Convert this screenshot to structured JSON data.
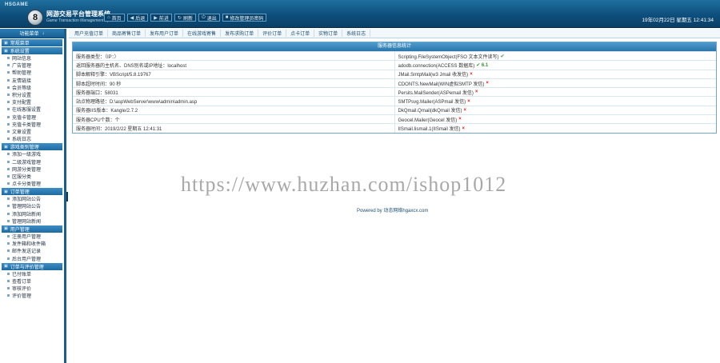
{
  "header": {
    "brand_tag": "HSGAME",
    "logo_letter": "8",
    "title": "网游交易平台管理系统",
    "subtitle": "Game Transaction Management System",
    "nav": [
      {
        "icon": "home-icon",
        "glyph": "⌂",
        "label": "首页"
      },
      {
        "icon": "back-icon",
        "glyph": "◀",
        "label": "后退"
      },
      {
        "icon": "forward-icon",
        "glyph": "▶",
        "label": "前进"
      },
      {
        "icon": "refresh-icon",
        "glyph": "↻",
        "label": "刷新"
      },
      {
        "icon": "logout-icon",
        "glyph": "⏻",
        "label": "退出"
      },
      {
        "icon": "user-icon",
        "glyph": "■",
        "label": "修改管理员密码"
      }
    ],
    "clock": "19年02月22日 星期五 12:41:34"
  },
  "sidebar": {
    "head_left": "功能菜单",
    "head_right": "↓",
    "sections": [
      {
        "title": "常规菜单",
        "items": []
      },
      {
        "title": "系统设置",
        "items": [
          "网站信息",
          "广告管理",
          "帮助管理",
          "友情链接",
          "会员等级",
          "积分设置",
          "支付配置",
          "在线客服设置",
          "充值卡管理",
          "充值卡类管理",
          "文章设置",
          "系统日志"
        ]
      },
      {
        "title": "游戏类别管理",
        "items": [
          "添加一级游戏",
          "二级游戏管理",
          "网游分类管理",
          "区服分类",
          "点卡分类管理"
        ]
      },
      {
        "title": "订单管理",
        "items": [
          "添加网站公告",
          "管理网站公告",
          "添加网站新闻",
          "管理网站新闻"
        ]
      },
      {
        "title": "用户管理",
        "items": [
          "注册用户管理",
          "发件箱和收件箱",
          "邮件发送记录",
          "后台用户管理"
        ]
      },
      {
        "title": "订单与评价管理",
        "items": [
          "已付账单",
          "查看订单",
          "审核评价",
          "评价管理"
        ]
      }
    ]
  },
  "tabs": [
    "用户充值订单",
    "商品寄售订单",
    "发布用户订单",
    "在线游戏寄售",
    "发布求购订单",
    "评价订单",
    "点卡订单",
    "实物订单",
    "系统日志"
  ],
  "server_info": {
    "title": "服务器信息统计",
    "rows": [
      {
        "left": "服务器类型：（IP：）",
        "right": "Scripting.FileSystemObject(FSO 文本文件读写)",
        "right_status": "✔",
        "right_ok": true
      },
      {
        "left": "返回服务器的主机名、DNS别名或IP地址：localhost",
        "right": "adodb.connection(ACCESS 数据库)",
        "right_status": "✔ 6.1",
        "right_ok": true
      },
      {
        "left": "脚本解释引擎：VBScript/5.8.19767",
        "right": "JMail.SmtpMail(w3 Jmail 收发信)",
        "right_status": "×",
        "right_ok": false
      },
      {
        "left": "脚本超时时间：90 秒",
        "right": "CDONTS.NewMail(WIN虚拟SMTP 发信)",
        "right_status": "×",
        "right_ok": false
      },
      {
        "left": "服务器端口：58031",
        "right": "Persits.MailSender(ASPemail 发信)",
        "right_status": "×",
        "right_ok": false
      },
      {
        "left": "站点物理路径：D:\\aspWebServer\\www\\admin\\admin.asp",
        "right": "SMTPsvg.Mailer(ASPmail 发信)",
        "right_status": "×",
        "right_ok": false
      },
      {
        "left": "服务器IIS版本：Kangle/2.7.2",
        "right": "DkQmail.Qmail(dkQmail 发信)",
        "right_status": "×",
        "right_ok": false
      },
      {
        "left": "服务器CPU个数：个",
        "right": "Geocel.Mailer(Geocel 发信)",
        "right_status": "×",
        "right_ok": false
      },
      {
        "left": "服务器时间：2019/2/22 星期五 12:41:31",
        "right": "IISmail.Iismail.1(IISmail 发信)",
        "right_status": "×",
        "right_ok": false
      }
    ]
  },
  "watermark": "https://www.huzhan.com/ishop1012",
  "powered": "Powered by 动态网络hgaxcx.com"
}
